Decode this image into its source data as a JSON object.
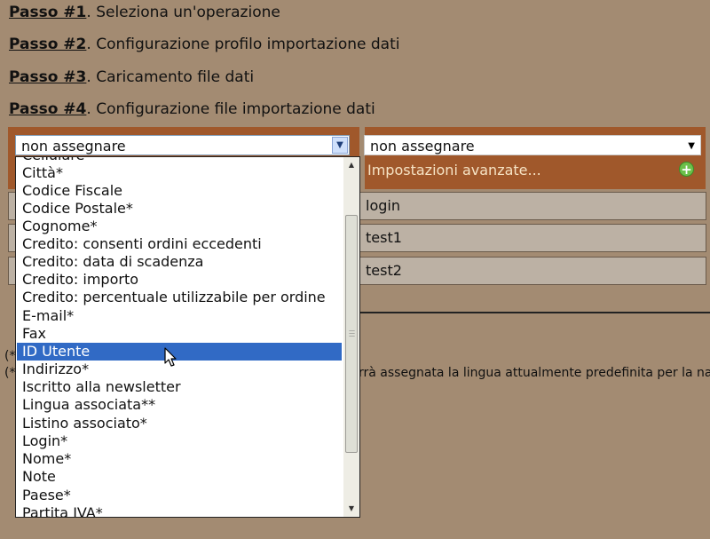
{
  "steps": [
    {
      "label": "Passo #1",
      "text": ". Seleziona un'operazione"
    },
    {
      "label": "Passo #2",
      "text": ". Configurazione profilo importazione dati"
    },
    {
      "label": "Passo #3",
      "text": ". Caricamento file dati"
    },
    {
      "label": "Passo #4",
      "text": ". Configurazione file importazione dati"
    }
  ],
  "mapping": {
    "select1_value": "non assegnare",
    "select2_value": "non assegnare",
    "advanced_label": "Impostazioni avanzate...",
    "plus_icon": "+"
  },
  "data_rows": [
    "login",
    "test1",
    "test2"
  ],
  "notes": {
    "left1": "(*",
    "left2": "(*",
    "right": "rrà assegnata la lingua attualmente predefinita per la navi"
  },
  "dropdown": {
    "options": [
      "Cellulare",
      "Città*",
      "Codice Fiscale",
      "Codice Postale*",
      "Cognome*",
      "Credito: consenti ordini eccedenti",
      "Credito: data di scadenza",
      "Credito: importo",
      "Credito: percentuale utilizzabile per ordine",
      "E-mail*",
      "Fax",
      "ID Utente",
      "Indirizzo*",
      "Iscritto alla newsletter",
      "Lingua associata**",
      "Listino associato*",
      "Login*",
      "Nome*",
      "Note",
      "Paese*",
      "Partita IVA*"
    ],
    "selected": "ID Utente"
  },
  "colors": {
    "background": "#a38b72",
    "bar": "#a0582b",
    "selection": "#316ac5"
  }
}
